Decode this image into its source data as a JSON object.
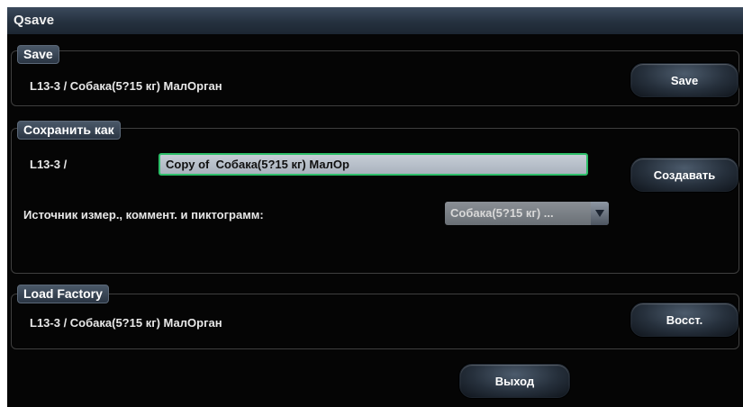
{
  "window": {
    "title": "Qsave"
  },
  "save_group": {
    "legend": "Save",
    "path": "L13-3  /  Собака(5?15 кг) МалОрган",
    "button_label": "Save"
  },
  "save_as_group": {
    "legend": "Сохранить как",
    "prefix": "L13-3  /",
    "name_value": "Copy of  Собака(5?15 кг) МалОр",
    "create_label": "Создавать",
    "source_label": "Источник измер., коммент. и пиктограмм:",
    "source_selected": "Собака(5?15 кг) ..."
  },
  "load_factory_group": {
    "legend": "Load Factory",
    "path": "L13-3  /  Собака(5?15 кг) МалОрган",
    "restore_label": "Восст."
  },
  "footer": {
    "exit_label": "Выход"
  },
  "icons": {
    "dropdown": "triangle-down-icon"
  },
  "colors": {
    "focus_border": "#2ebf6a",
    "background": "#050505"
  }
}
